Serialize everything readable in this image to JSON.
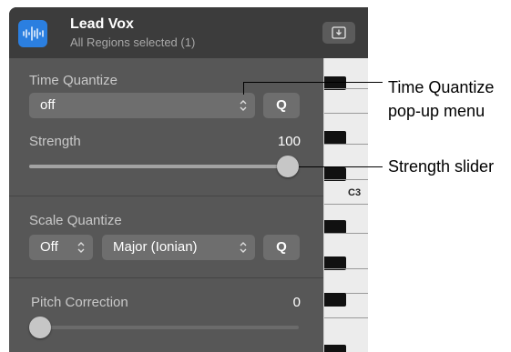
{
  "header": {
    "track_name": "Lead Vox",
    "track_subtitle": "All Regions selected (1)",
    "track_icon": "waveform-icon",
    "action_icon": "download-tray-icon"
  },
  "time_quantize": {
    "label": "Time Quantize",
    "value": "off",
    "button": "Q"
  },
  "strength": {
    "label": "Strength",
    "value": "100",
    "level": 1.0
  },
  "scale_quantize": {
    "label": "Scale Quantize",
    "value": "Off",
    "scale": "Major (Ionian)",
    "button": "Q"
  },
  "pitch_correction": {
    "label": "Pitch Correction",
    "value": "0",
    "level": 0.0
  },
  "piano": {
    "note_label": "C3"
  },
  "callouts": {
    "time_quantize": "Time Quantize\npop-up menu",
    "strength": "Strength slider"
  },
  "colors": {
    "panel": "#575757",
    "header": "#3c3c3c",
    "accent": "#2b7fe0"
  }
}
